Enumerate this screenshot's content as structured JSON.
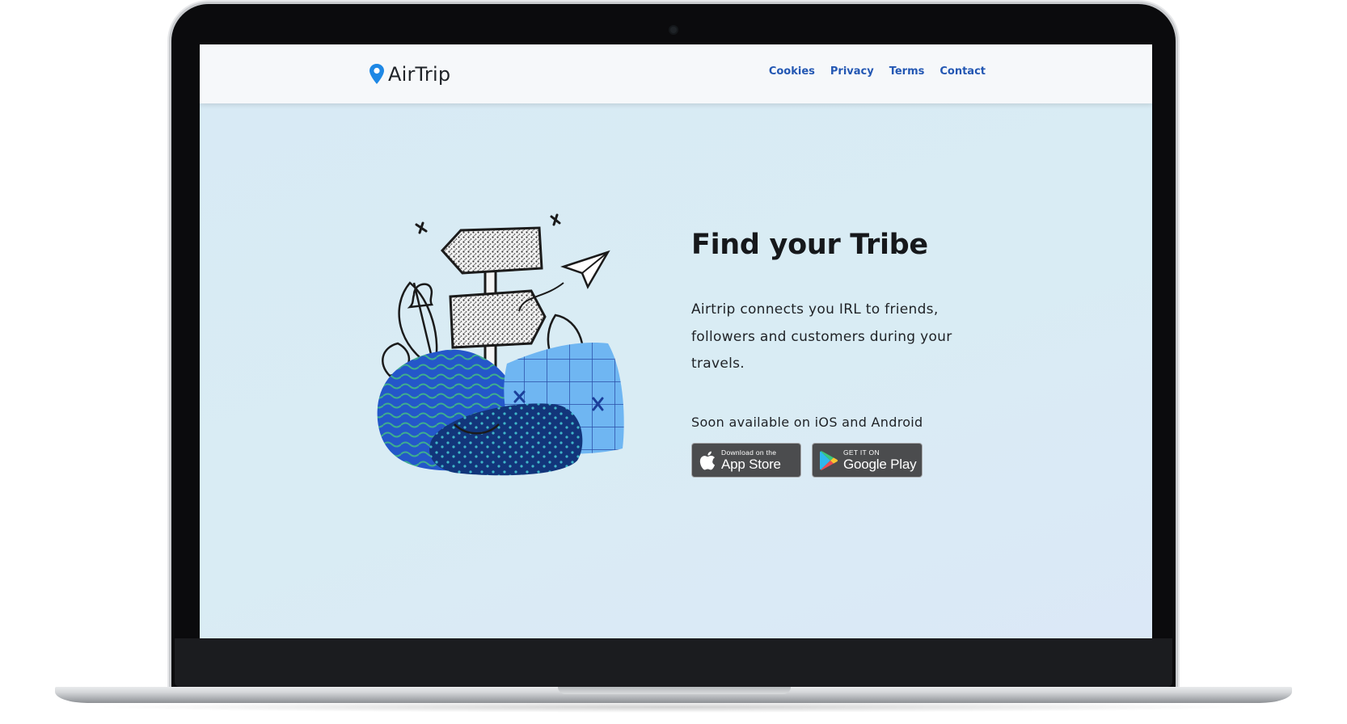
{
  "brand": {
    "name": "AirTrip",
    "accent": "#1e88e5"
  },
  "nav": {
    "items": [
      {
        "label": "Cookies"
      },
      {
        "label": "Privacy"
      },
      {
        "label": "Terms"
      },
      {
        "label": "Contact"
      }
    ],
    "color": "#2357b3"
  },
  "hero": {
    "title": "Find your Tribe",
    "description": "Airtrip connects you IRL to friends, followers and customers during your travels.",
    "availability": "Soon available on iOS and Android"
  },
  "stores": {
    "appstore": {
      "small": "Download on the",
      "big": "App Store",
      "icon": "apple-icon"
    },
    "googleplay": {
      "small": "GET IT ON",
      "big": "Google Play",
      "icon": "google-play-icon"
    }
  },
  "illustration": {
    "icon": "signpost-travel-illustration"
  }
}
